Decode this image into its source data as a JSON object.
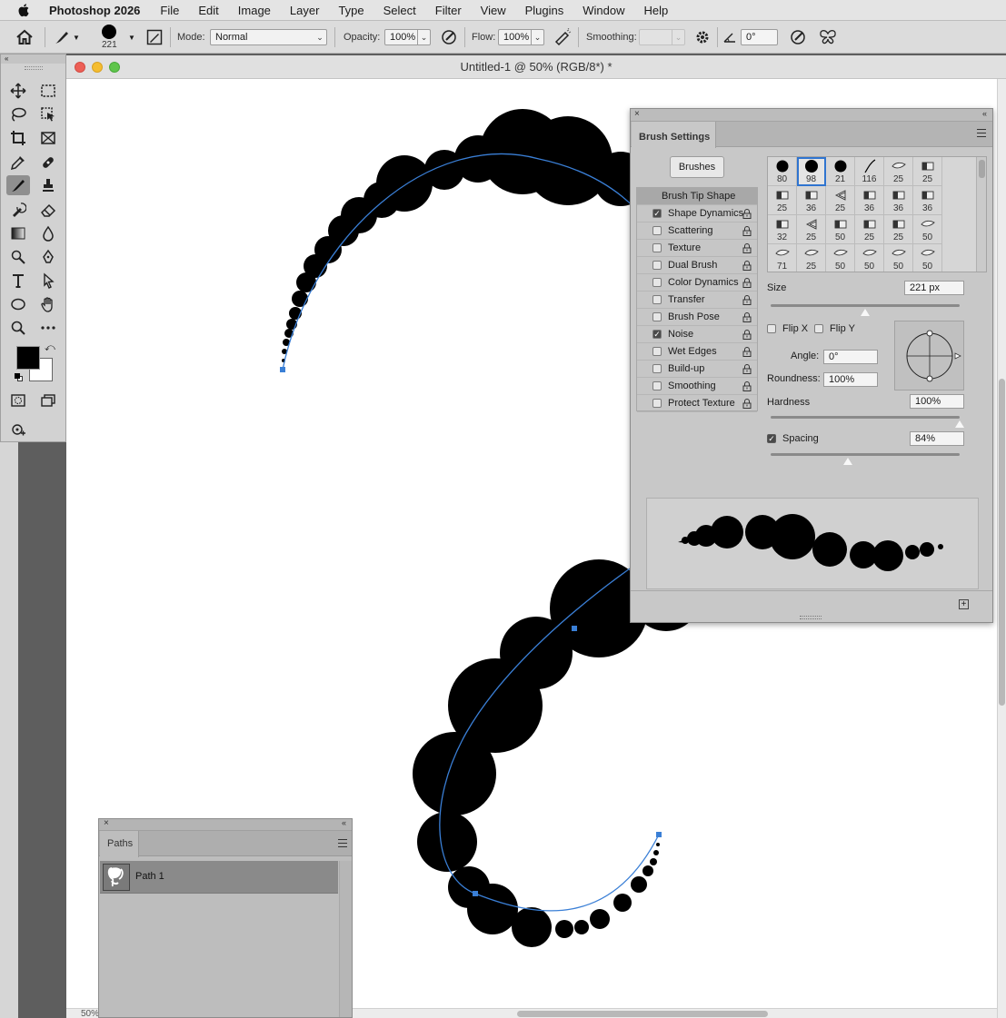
{
  "menubar": {
    "app_name": "Photoshop 2026",
    "items": [
      "File",
      "Edit",
      "Image",
      "Layer",
      "Type",
      "Select",
      "Filter",
      "View",
      "Plugins",
      "Window",
      "Help"
    ]
  },
  "options": {
    "brush_size": "221",
    "mode_label": "Mode:",
    "mode_value": "Normal",
    "opacity_label": "Opacity:",
    "opacity_value": "100%",
    "flow_label": "Flow:",
    "flow_value": "100%",
    "smoothing_label": "Smoothing:",
    "smoothing_value": "",
    "angle_value": "0°"
  },
  "document": {
    "title": "Untitled-1 @ 50% (RGB/8*) *",
    "zoom_partial": "50%"
  },
  "brush_settings": {
    "tab_label": "Brush Settings",
    "brushes_button": "Brushes",
    "options": [
      {
        "label": "Brush Tip Shape",
        "checkbox": false,
        "checked": false,
        "selected": true
      },
      {
        "label": "Shape Dynamics",
        "checkbox": true,
        "checked": true
      },
      {
        "label": "Scattering",
        "checkbox": true,
        "checked": false
      },
      {
        "label": "Texture",
        "checkbox": true,
        "checked": false
      },
      {
        "label": "Dual Brush",
        "checkbox": true,
        "checked": false
      },
      {
        "label": "Color Dynamics",
        "checkbox": true,
        "checked": false
      },
      {
        "label": "Transfer",
        "checkbox": true,
        "checked": false
      },
      {
        "label": "Brush Pose",
        "checkbox": true,
        "checked": false
      },
      {
        "label": "Noise",
        "checkbox": true,
        "checked": true
      },
      {
        "label": "Wet Edges",
        "checkbox": true,
        "checked": false
      },
      {
        "label": "Build-up",
        "checkbox": true,
        "checked": false
      },
      {
        "label": "Smoothing",
        "checkbox": true,
        "checked": false
      },
      {
        "label": "Protect Texture",
        "checkbox": true,
        "checked": false
      }
    ],
    "tips": [
      {
        "size": "80",
        "shape": "round"
      },
      {
        "size": "98",
        "shape": "round",
        "selected": true
      },
      {
        "size": "21",
        "shape": "round"
      },
      {
        "size": "116",
        "shape": "stroke"
      },
      {
        "size": "25",
        "shape": "chisel"
      },
      {
        "size": "25",
        "shape": "flat"
      },
      {
        "size": "25",
        "shape": "flat"
      },
      {
        "size": "36",
        "shape": "flat"
      },
      {
        "size": "25",
        "shape": "fan"
      },
      {
        "size": "36",
        "shape": "flat"
      },
      {
        "size": "36",
        "shape": "flat"
      },
      {
        "size": "36",
        "shape": "flat"
      },
      {
        "size": "32",
        "shape": "flat"
      },
      {
        "size": "25",
        "shape": "fan"
      },
      {
        "size": "50",
        "shape": "flat"
      },
      {
        "size": "25",
        "shape": "flat"
      },
      {
        "size": "25",
        "shape": "flat"
      },
      {
        "size": "50",
        "shape": "chisel"
      },
      {
        "size": "71",
        "shape": "chisel"
      },
      {
        "size": "25",
        "shape": "chisel"
      },
      {
        "size": "50",
        "shape": "chisel"
      },
      {
        "size": "50",
        "shape": "chisel"
      },
      {
        "size": "50",
        "shape": "chisel"
      },
      {
        "size": "50",
        "shape": "chisel"
      }
    ],
    "size_label": "Size",
    "size_value": "221 px",
    "size_level": 0.5,
    "flip_x_label": "Flip X",
    "flip_y_label": "Flip Y",
    "angle_label": "Angle:",
    "angle_value": "0°",
    "roundness_label": "Roundness:",
    "roundness_value": "100%",
    "hardness_label": "Hardness",
    "hardness_value": "100%",
    "hardness_level": 1.0,
    "spacing_label": "Spacing",
    "spacing_value": "84%",
    "spacing_checked": true,
    "spacing_level": 0.41
  },
  "paths": {
    "tab_label": "Paths",
    "items": [
      {
        "label": "Path 1"
      }
    ]
  },
  "colors": {
    "path_stroke": "#3a7fd6",
    "foreground": "#000000",
    "background": "#ffffff"
  }
}
